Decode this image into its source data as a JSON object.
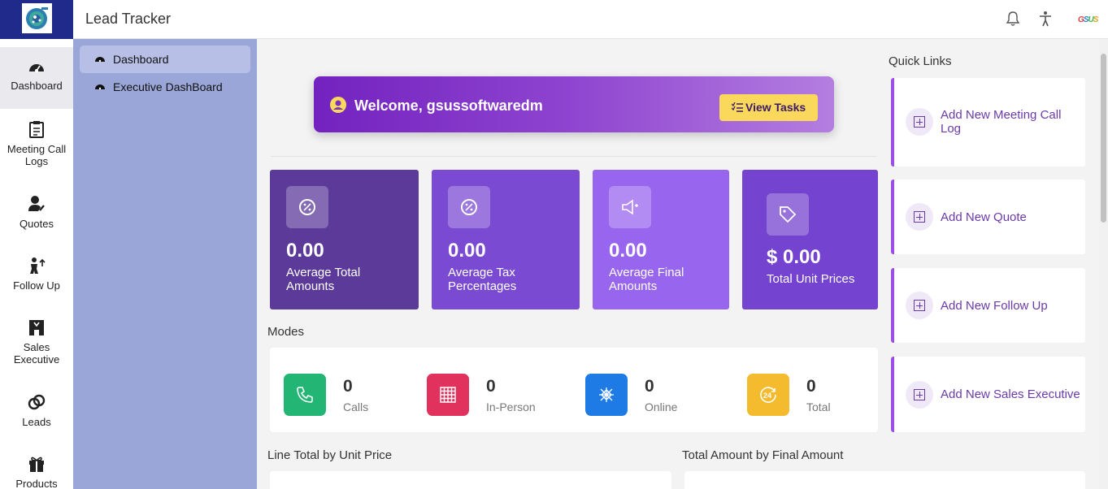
{
  "app": {
    "title": "Lead Tracker",
    "brand": "GSUS"
  },
  "rail": [
    {
      "label": "Dashboard",
      "icon": "gauge-icon"
    },
    {
      "label": "Meeting Call Logs",
      "icon": "clipboard-icon"
    },
    {
      "label": "Quotes",
      "icon": "user-edit-icon"
    },
    {
      "label": "Follow Up",
      "icon": "person-up-icon"
    },
    {
      "label": "Sales Executive",
      "icon": "executive-icon"
    },
    {
      "label": "Leads",
      "icon": "link-icon"
    },
    {
      "label": "Products",
      "icon": "gift-icon"
    }
  ],
  "submenu": [
    {
      "label": "Dashboard"
    },
    {
      "label": "Executive DashBoard"
    }
  ],
  "welcome": {
    "text": "Welcome, gsussoftwaredm",
    "button": "View Tasks"
  },
  "stats": [
    {
      "value": "0.00",
      "label": "Average Total Amounts",
      "color": "#5b3a9a"
    },
    {
      "value": "0.00",
      "label": "Average Tax Percentages",
      "color": "#7a4ad3"
    },
    {
      "value": "0.00",
      "label": "Average Final Amounts",
      "color": "#9866ee"
    },
    {
      "value": "$ 0.00",
      "label": "Total Unit Prices",
      "color": "#7443cf"
    }
  ],
  "modes": {
    "title": "Modes",
    "items": [
      {
        "value": "0",
        "label": "Calls",
        "color": "#22b573"
      },
      {
        "value": "0",
        "label": "In-Person",
        "color": "#e0325c"
      },
      {
        "value": "0",
        "label": "Online",
        "color": "#1e7be6"
      },
      {
        "value": "0",
        "label": "Total",
        "color": "#f4bb2e"
      }
    ]
  },
  "charts": {
    "left_title": "Line Total by Unit Price",
    "right_title": "Total Amount by Final Amount"
  },
  "quick_links": {
    "title": "Quick Links",
    "items": [
      {
        "label": "Add New Meeting Call Log"
      },
      {
        "label": "Add New Quote"
      },
      {
        "label": "Add New Follow Up"
      },
      {
        "label": "Add New Sales Executive"
      }
    ]
  }
}
